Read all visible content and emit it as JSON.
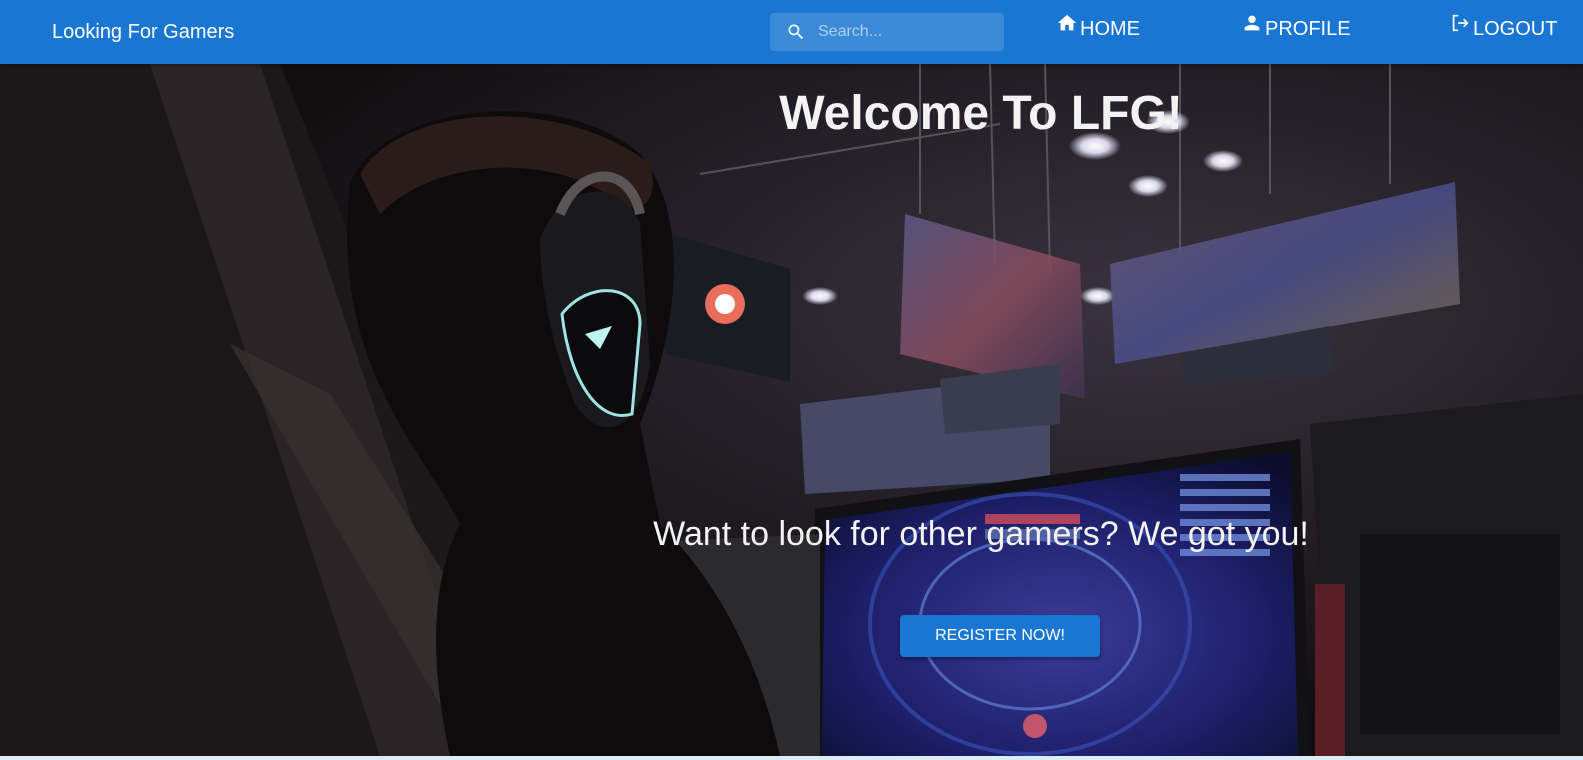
{
  "appbar": {
    "brand": "Looking For Gamers",
    "search_placeholder": "Search...",
    "search_icon": "search-icon",
    "nav": [
      {
        "label": "HOME",
        "icon": "home-icon"
      },
      {
        "label": "PROFILE",
        "icon": "person-icon"
      },
      {
        "label": "LOGOUT",
        "icon": "logout-icon"
      }
    ]
  },
  "hero": {
    "title": "Welcome To LFG!",
    "subtitle": "Want to look for other gamers? We got you!",
    "cta_label": "REGISTER NOW!"
  },
  "colors": {
    "primary": "#1976d2",
    "hero_dark": "#120f10"
  }
}
